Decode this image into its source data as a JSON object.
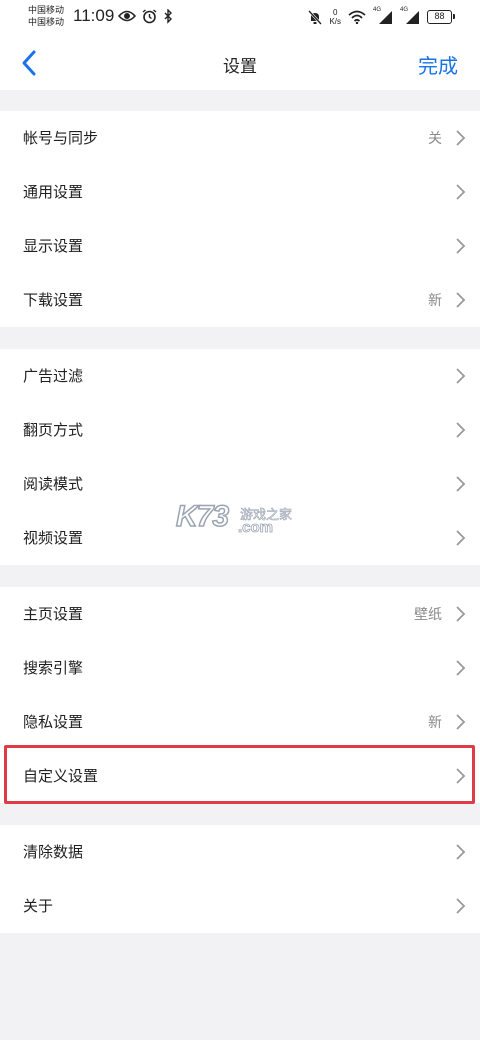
{
  "status_bar": {
    "carrier_1": "中国移动",
    "carrier_2": "中国移动",
    "time": "11:09",
    "net_speed_value": "0",
    "net_speed_unit": "K/s",
    "signal_1": "4G",
    "signal_2": "4G",
    "battery": "88"
  },
  "header": {
    "title": "设置",
    "done_label": "完成"
  },
  "groups": [
    {
      "items": [
        {
          "label": "帐号与同步",
          "value": "关"
        },
        {
          "label": "通用设置",
          "value": ""
        },
        {
          "label": "显示设置",
          "value": ""
        },
        {
          "label": "下载设置",
          "value": "新"
        }
      ]
    },
    {
      "items": [
        {
          "label": "广告过滤",
          "value": ""
        },
        {
          "label": "翻页方式",
          "value": ""
        },
        {
          "label": "阅读模式",
          "value": ""
        },
        {
          "label": "视频设置",
          "value": ""
        }
      ]
    },
    {
      "items": [
        {
          "label": "主页设置",
          "value": "壁纸"
        },
        {
          "label": "搜索引擎",
          "value": ""
        },
        {
          "label": "隐私设置",
          "value": "新"
        },
        {
          "label": "自定义设置",
          "value": ""
        }
      ]
    },
    {
      "items": [
        {
          "label": "清除数据",
          "value": ""
        },
        {
          "label": "关于",
          "value": ""
        }
      ]
    }
  ],
  "watermark": {
    "brand": "K73",
    "domain": ".com",
    "tagline": "游戏之家"
  },
  "colors": {
    "accent": "#1a73e8",
    "highlight": "#e03a47",
    "background": "#f2f2f4"
  }
}
